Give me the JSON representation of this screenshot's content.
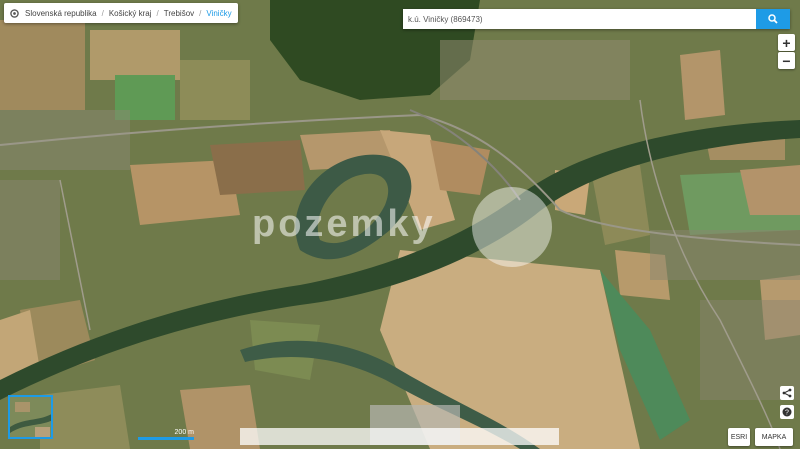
{
  "breadcrumb": [
    "Slovenská republika",
    "Košický kraj",
    "Trebišov",
    "Viničky"
  ],
  "search": {
    "value": "k.ú. Viničky (869473)"
  },
  "zoom": {
    "in": "+",
    "out": "−"
  },
  "watermark": "pozemky",
  "scale": {
    "label": "200 m"
  },
  "layers": {
    "esri": "ESRI",
    "mapka": "MAPKA"
  },
  "colors": {
    "accent": "#1e9be6",
    "river": "#3b5b45",
    "field": "#b89a6a"
  },
  "icons": [
    "home-icon",
    "search-icon",
    "share-icon",
    "help-icon"
  ]
}
